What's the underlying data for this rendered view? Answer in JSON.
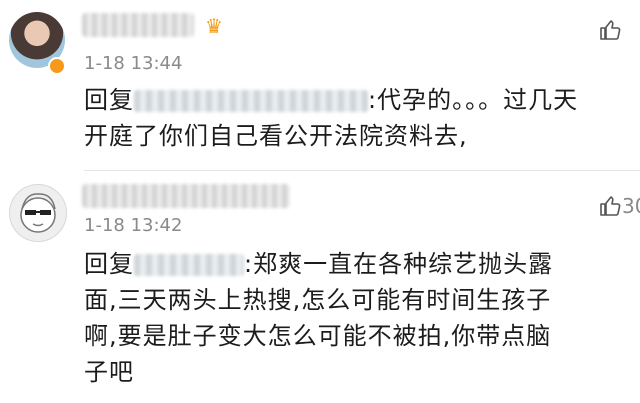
{
  "comments": [
    {
      "time": "1-18 13:44",
      "reply_prefix": "回复",
      "text_line1": ":代孕的。。。过几天",
      "text_line2": "开庭了你们自己看公开法院资料去,",
      "like_count": ""
    },
    {
      "time": "1-18 13:42",
      "reply_prefix": "回复",
      "text_line1": ":郑爽一直在各种综艺抛头露",
      "text_line2": "面,三天两头上热搜,怎么可能有时间生孩子",
      "text_line3": "啊,要是肚子变大怎么可能不被拍,你带点脑",
      "text_line4": "子吧",
      "like_count": "30"
    }
  ],
  "icons": {
    "like": "thumbs-up-icon",
    "vip": "vip-badge-icon",
    "verified": "verified-badge-icon"
  },
  "colors": {
    "time": "#8a8a8a",
    "badge": "#f79a1b",
    "divider": "#e4e4e4"
  }
}
